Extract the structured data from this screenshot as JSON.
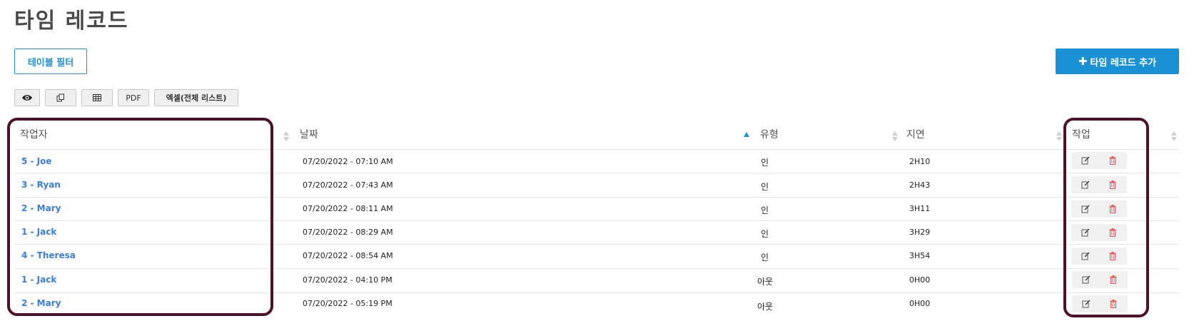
{
  "page": {
    "title": "타임 레코드"
  },
  "toolbar": {
    "filter_label": "테이블 필터",
    "add_label": "타임 레코드 추가",
    "pdf_label": "PDF",
    "excel_label": "엑셀(전체 리스트)"
  },
  "table": {
    "columns": [
      "작업자",
      "날짜",
      "유형",
      "지연",
      "작업"
    ],
    "sorted_column": "날짜",
    "rows": [
      {
        "worker": "5 - Joe",
        "date": "07/20/2022 - 07:10 AM",
        "type": "인",
        "delay": "2H10"
      },
      {
        "worker": "3 - Ryan",
        "date": "07/20/2022 - 07:43 AM",
        "type": "인",
        "delay": "2H43"
      },
      {
        "worker": "2 - Mary",
        "date": "07/20/2022 - 08:11 AM",
        "type": "인",
        "delay": "3H11"
      },
      {
        "worker": "1 - Jack",
        "date": "07/20/2022 - 08:29 AM",
        "type": "인",
        "delay": "3H29"
      },
      {
        "worker": "4 - Theresa",
        "date": "07/20/2022 - 08:54 AM",
        "type": "인",
        "delay": "3H54"
      },
      {
        "worker": "1 - Jack",
        "date": "07/20/2022 - 04:10 PM",
        "type": "아웃",
        "delay": "0H00"
      },
      {
        "worker": "2 - Mary",
        "date": "07/20/2022 - 05:19 PM",
        "type": "아웃",
        "delay": "0H00"
      }
    ]
  },
  "colors": {
    "accent": "#1a91d5",
    "link": "#3b7dd8",
    "highlight": "#4d1129",
    "delete": "#e05555"
  }
}
